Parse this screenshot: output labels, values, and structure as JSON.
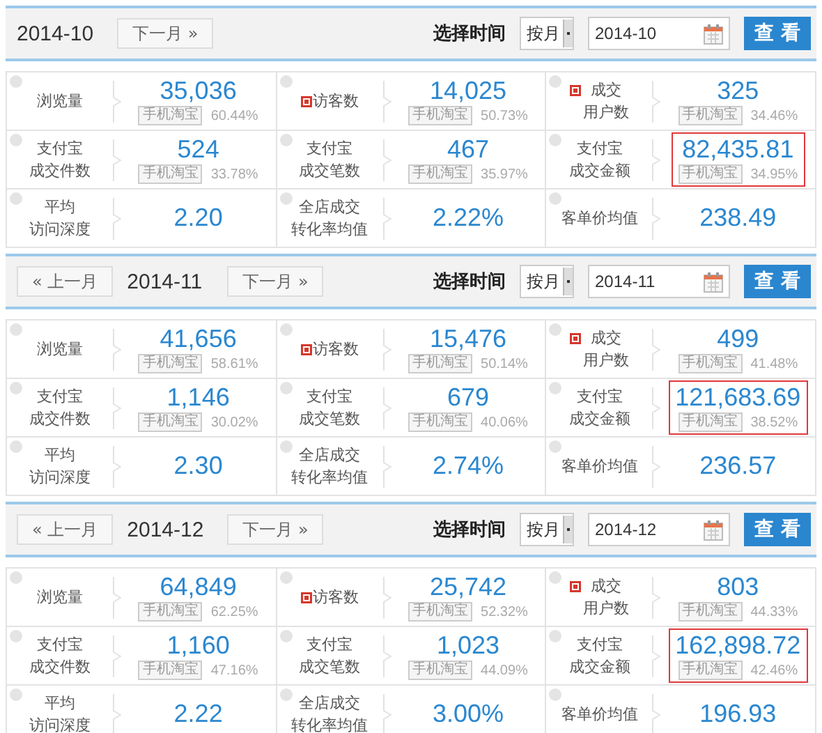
{
  "periods": [
    {
      "month": "2014-10",
      "next_button": {
        "label": "下一月",
        "arrow": "»"
      },
      "select_label": "选择时间",
      "mode": "按月",
      "date_value": "2014-10",
      "query_button": "查 看",
      "metrics": [
        {
          "label": [
            "浏览量"
          ],
          "flagged": false,
          "value": "35,036",
          "badge": "手机淘宝",
          "share": "60.44%",
          "highlighted": false
        },
        {
          "label": [
            "访客数"
          ],
          "flagged": true,
          "value": "14,025",
          "badge": "手机淘宝",
          "share": "50.73%",
          "highlighted": false
        },
        {
          "label": [
            "成交",
            "用户数"
          ],
          "flagged": true,
          "value": "325",
          "badge": "手机淘宝",
          "share": "34.46%",
          "highlighted": false
        },
        {
          "label": [
            "支付宝",
            "成交件数"
          ],
          "flagged": false,
          "value": "524",
          "badge": "手机淘宝",
          "share": "33.78%",
          "highlighted": false
        },
        {
          "label": [
            "支付宝",
            "成交笔数"
          ],
          "flagged": false,
          "value": "467",
          "badge": "手机淘宝",
          "share": "35.97%",
          "highlighted": false
        },
        {
          "label": [
            "支付宝",
            "成交金额"
          ],
          "flagged": false,
          "value": "82,435.81",
          "badge": "手机淘宝",
          "share": "34.95%",
          "highlighted": true
        },
        {
          "label": [
            "平均",
            "访问深度"
          ],
          "flagged": false,
          "value": "2.20",
          "highlighted": false
        },
        {
          "label": [
            "全店成交",
            "转化率均值"
          ],
          "flagged": false,
          "value": "2.22%",
          "highlighted": false
        },
        {
          "label": [
            "客单价均值"
          ],
          "flagged": false,
          "value": "238.49",
          "highlighted": false
        }
      ]
    },
    {
      "month": "2014-11",
      "prev_button": {
        "label": "上一月",
        "arrow": "«"
      },
      "next_button": {
        "label": "下一月",
        "arrow": "»"
      },
      "select_label": "选择时间",
      "mode": "按月",
      "date_value": "2014-11",
      "query_button": "查 看",
      "metrics": [
        {
          "label": [
            "浏览量"
          ],
          "flagged": false,
          "value": "41,656",
          "badge": "手机淘宝",
          "share": "58.61%",
          "highlighted": false
        },
        {
          "label": [
            "访客数"
          ],
          "flagged": true,
          "value": "15,476",
          "badge": "手机淘宝",
          "share": "50.14%",
          "highlighted": false
        },
        {
          "label": [
            "成交",
            "用户数"
          ],
          "flagged": true,
          "value": "499",
          "badge": "手机淘宝",
          "share": "41.48%",
          "highlighted": false
        },
        {
          "label": [
            "支付宝",
            "成交件数"
          ],
          "flagged": false,
          "value": "1,146",
          "badge": "手机淘宝",
          "share": "30.02%",
          "highlighted": false
        },
        {
          "label": [
            "支付宝",
            "成交笔数"
          ],
          "flagged": false,
          "value": "679",
          "badge": "手机淘宝",
          "share": "40.06%",
          "highlighted": false
        },
        {
          "label": [
            "支付宝",
            "成交金额"
          ],
          "flagged": false,
          "value": "121,683.69",
          "badge": "手机淘宝",
          "share": "38.52%",
          "highlighted": true
        },
        {
          "label": [
            "平均",
            "访问深度"
          ],
          "flagged": false,
          "value": "2.30",
          "highlighted": false
        },
        {
          "label": [
            "全店成交",
            "转化率均值"
          ],
          "flagged": false,
          "value": "2.74%",
          "highlighted": false
        },
        {
          "label": [
            "客单价均值"
          ],
          "flagged": false,
          "value": "236.57",
          "highlighted": false
        }
      ]
    },
    {
      "month": "2014-12",
      "prev_button": {
        "label": "上一月",
        "arrow": "«"
      },
      "next_button": {
        "label": "下一月",
        "arrow": "»"
      },
      "select_label": "选择时间",
      "mode": "按月",
      "date_value": "2014-12",
      "query_button": "查 看",
      "metrics": [
        {
          "label": [
            "浏览量"
          ],
          "flagged": false,
          "value": "64,849",
          "badge": "手机淘宝",
          "share": "62.25%",
          "highlighted": false
        },
        {
          "label": [
            "访客数"
          ],
          "flagged": true,
          "value": "25,742",
          "badge": "手机淘宝",
          "share": "52.32%",
          "highlighted": false
        },
        {
          "label": [
            "成交",
            "用户数"
          ],
          "flagged": true,
          "value": "803",
          "badge": "手机淘宝",
          "share": "44.33%",
          "highlighted": false
        },
        {
          "label": [
            "支付宝",
            "成交件数"
          ],
          "flagged": false,
          "value": "1,160",
          "badge": "手机淘宝",
          "share": "47.16%",
          "highlighted": false
        },
        {
          "label": [
            "支付宝",
            "成交笔数"
          ],
          "flagged": false,
          "value": "1,023",
          "badge": "手机淘宝",
          "share": "44.09%",
          "highlighted": false
        },
        {
          "label": [
            "支付宝",
            "成交金额"
          ],
          "flagged": false,
          "value": "162,898.72",
          "badge": "手机淘宝",
          "share": "42.46%",
          "highlighted": true
        },
        {
          "label": [
            "平均",
            "访问深度"
          ],
          "flagged": false,
          "value": "2.22",
          "highlighted": false
        },
        {
          "label": [
            "全店成交",
            "转化率均值"
          ],
          "flagged": false,
          "value": "3.00%",
          "highlighted": false
        },
        {
          "label": [
            "客单价均值"
          ],
          "flagged": false,
          "value": "196.93",
          "highlighted": false
        }
      ]
    }
  ]
}
